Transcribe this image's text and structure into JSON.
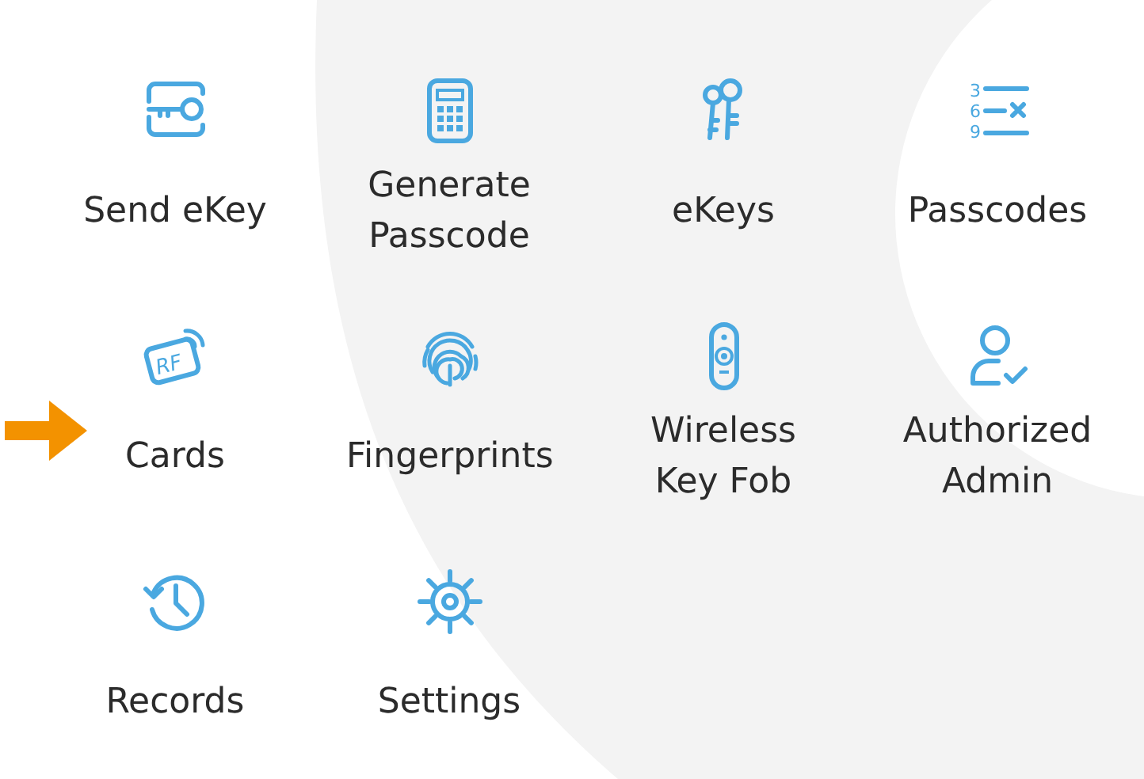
{
  "menu": [
    {
      "kind": "key-card",
      "label": "Send eKey"
    },
    {
      "kind": "calculator",
      "label": "Generate Passcode"
    },
    {
      "kind": "keys",
      "label": "eKeys"
    },
    {
      "kind": "number-list",
      "label": "Passcodes",
      "icon_digits": [
        "3",
        "6",
        "9"
      ]
    },
    {
      "kind": "rf-card",
      "label": "Cards",
      "icon_text": "RF",
      "pointed": true
    },
    {
      "kind": "fingerprint",
      "label": "Fingerprints"
    },
    {
      "kind": "key-fob",
      "label": "Wireless Key Fob"
    },
    {
      "kind": "user-check",
      "label": "Authorized Admin"
    },
    {
      "kind": "history",
      "label": "Records"
    },
    {
      "kind": "gear",
      "label": "Settings"
    }
  ]
}
